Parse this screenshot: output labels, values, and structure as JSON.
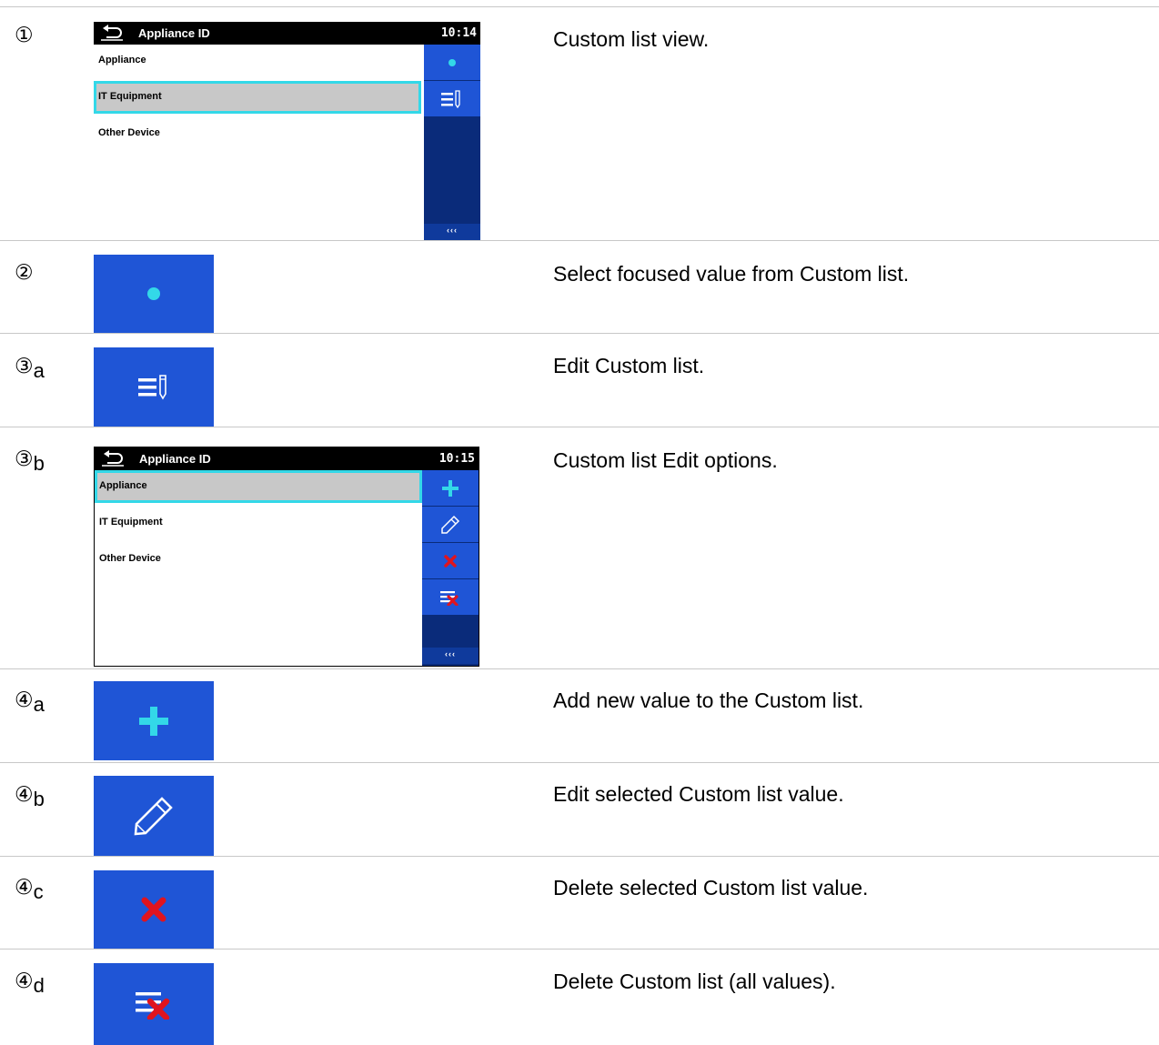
{
  "rows": [
    {
      "num": "①",
      "sub": "",
      "desc": "Custom list view."
    },
    {
      "num": "②",
      "sub": "",
      "desc": "Select focused value from Custom list."
    },
    {
      "num": "③",
      "sub": "a",
      "desc": "Edit Custom list."
    },
    {
      "num": "③",
      "sub": "b",
      "desc": "Custom list Edit options."
    },
    {
      "num": "④",
      "sub": "a",
      "desc": "Add new value to the Custom list."
    },
    {
      "num": "④",
      "sub": "b",
      "desc": "Edit selected Custom list value."
    },
    {
      "num": "④",
      "sub": "c",
      "desc": "Delete selected Custom list value."
    },
    {
      "num": "④",
      "sub": "d",
      "desc": "Delete Custom list (all values)."
    }
  ],
  "screen1": {
    "title": "Appliance ID",
    "time": "10:14",
    "items": [
      "Appliance",
      "IT Equipment",
      "Other Device"
    ],
    "nav": "‹‹‹"
  },
  "screen2": {
    "title": "Appliance ID",
    "time": "10:15",
    "items": [
      "Appliance",
      "IT Equipment",
      "Other Device"
    ],
    "nav": "‹‹‹"
  },
  "colors": {
    "button_blue": "#1f55d6",
    "panel_navy": "#0a2b7a",
    "accent_cyan": "#33d8e8",
    "delete_red": "#e0141e",
    "selection_gray": "#c8c8c8"
  },
  "icons": {
    "back": "back-arrow-icon",
    "select": "dot-icon",
    "edit_list": "list-edit-icon",
    "add": "plus-icon",
    "edit": "pencil-icon",
    "delete": "x-icon",
    "delete_all": "list-delete-icon"
  }
}
